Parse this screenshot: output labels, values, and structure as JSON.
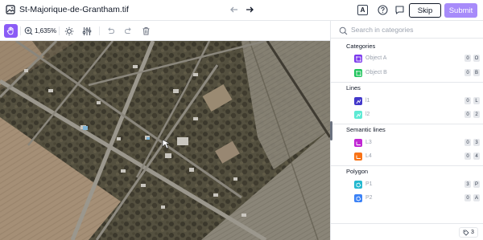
{
  "header": {
    "filename": "St-Majorique-de-Grantham.tif",
    "skip_label": "Skip",
    "submit_label": "Submit",
    "kbd_glyph": "A"
  },
  "toolbar": {
    "zoom_label": "1,635%"
  },
  "panel": {
    "search_placeholder": "Search in categories",
    "sections": [
      {
        "title": "Categories",
        "items": [
          {
            "label": "Object A",
            "color": "#7c3aed",
            "keys": [
              "0",
              "O"
            ]
          },
          {
            "label": "Object B",
            "color": "#22c55e",
            "keys": [
              "0",
              "B"
            ]
          }
        ]
      },
      {
        "title": "Lines",
        "items": [
          {
            "label": "l1",
            "color": "#4338ca",
            "keys": [
              "0",
              "L"
            ]
          },
          {
            "label": "l2",
            "color": "#5eead4",
            "keys": [
              "0",
              "2"
            ]
          }
        ]
      },
      {
        "title": "Semantic lines",
        "items": [
          {
            "label": "L3",
            "color": "#c026d3",
            "keys": [
              "0",
              "3"
            ]
          },
          {
            "label": "L4",
            "color": "#f97316",
            "keys": [
              "0",
              "4"
            ]
          }
        ]
      },
      {
        "title": "Polygon",
        "items": [
          {
            "label": "P1",
            "color": "#22b8cf",
            "keys": [
              "3",
              "P"
            ]
          },
          {
            "label": "P2",
            "color": "#3b82f6",
            "keys": [
              "0",
              "A"
            ]
          }
        ]
      }
    ]
  },
  "footer": {
    "tag_count": "3"
  },
  "colors": {
    "accent": "#8b5cf6",
    "submit": "#a78bfa"
  }
}
